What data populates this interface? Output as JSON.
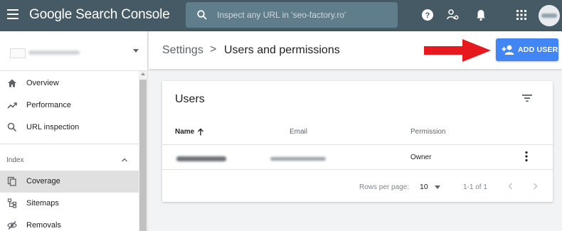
{
  "colors": {
    "topbar": "#455a64",
    "accent": "#4285f4",
    "arrow": "#e8191e"
  },
  "topbar": {
    "brand_main": "Google",
    "brand_rest": "Search Console",
    "search_placeholder": "Inspect any URL in 'seo-factory.ro'",
    "icons": [
      "menu-icon",
      "search-icon",
      "help-icon",
      "manage-accounts-icon",
      "notifications-icon",
      "apps-icon"
    ]
  },
  "sidebar": {
    "items": [
      {
        "label": "Overview",
        "icon": "home-icon"
      },
      {
        "label": "Performance",
        "icon": "trending-up-icon"
      },
      {
        "label": "URL inspection",
        "icon": "search-icon"
      }
    ],
    "section": "Index",
    "index_items": [
      {
        "label": "Coverage",
        "icon": "copy-icon",
        "active": true
      },
      {
        "label": "Sitemaps",
        "icon": "sitemap-icon"
      },
      {
        "label": "Removals",
        "icon": "visibility-off-icon"
      }
    ]
  },
  "header": {
    "breadcrumb_root": "Settings",
    "separator": ">",
    "title": "Users and permissions",
    "add_user_label": "ADD USER"
  },
  "card": {
    "title": "Users",
    "columns": [
      "Name",
      "Email",
      "Permission"
    ],
    "rows": [
      {
        "permission": "Owner"
      }
    ],
    "footer": {
      "rows_label": "Rows per page:",
      "rows_value": "10",
      "range": "1-1 of 1"
    }
  }
}
